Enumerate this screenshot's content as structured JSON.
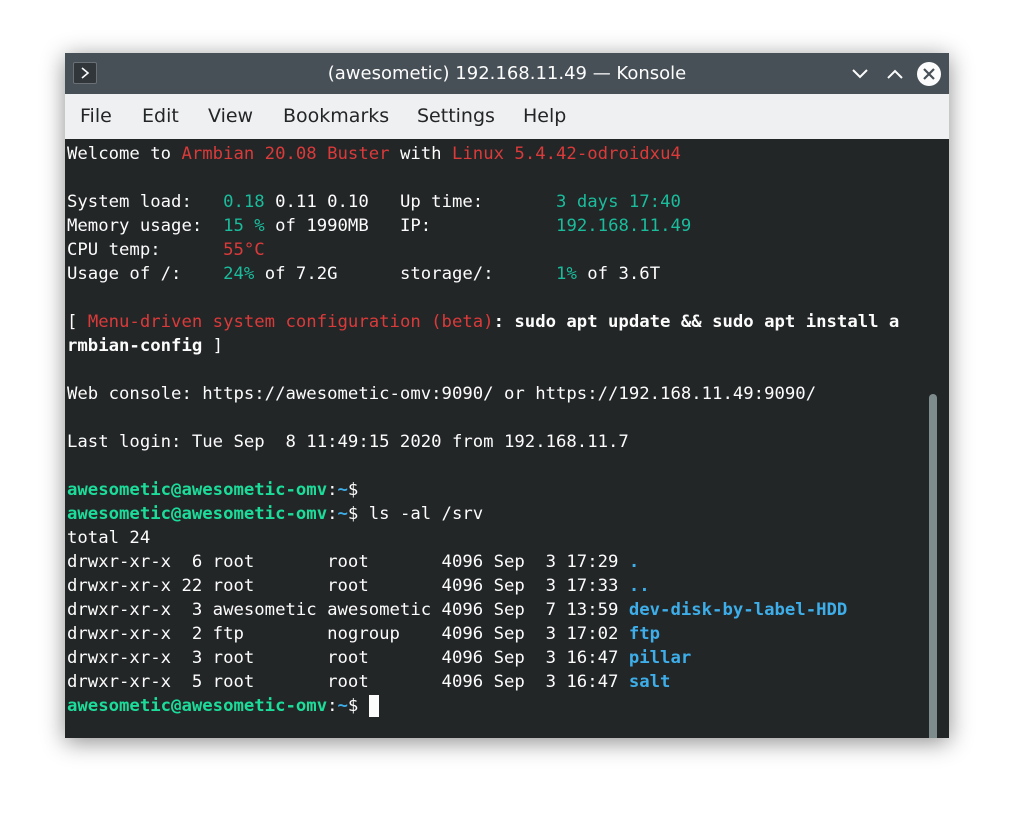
{
  "window": {
    "title": "(awesometic) 192.168.11.49 — Konsole"
  },
  "menubar": {
    "items": [
      "File",
      "Edit",
      "View",
      "Bookmarks",
      "Settings",
      "Help"
    ]
  },
  "terminal": {
    "welcome": {
      "prefix": "Welcome to ",
      "distro": "Armbian 20.08 Buster",
      "mid": " with ",
      "kernel": "Linux 5.4.42-odroidxu4"
    },
    "sysload": {
      "label": "System load:   ",
      "v1": "0.18",
      "rest": " 0.11 0.10   ",
      "uplabel": "Up time:       ",
      "upval": "3 days 17:40"
    },
    "memory": {
      "label": "Memory usage:  ",
      "val": "15 %",
      "rest": " of 1990MB   ",
      "iplabel": "IP:            ",
      "ipval": "192.168.11.49"
    },
    "cpu": {
      "label": "CPU temp:      ",
      "val": "55°C"
    },
    "usage": {
      "label": "Usage of /:    ",
      "val": "24%",
      "rest": " of 7.2G      ",
      "storlabel": "storage/:      ",
      "storval": "1%",
      "storrest": " of 3.6T"
    },
    "config": {
      "open": "[ ",
      "text": "Menu-driven system configuration (beta)",
      "cmd1": ": sudo apt update && sudo apt install a",
      "cmd2": "rmbian-config",
      "close": " ]"
    },
    "webconsole": "Web console: https://awesometic-omv:9090/ or https://192.168.11.49:9090/",
    "lastlogin": "Last login: Tue Sep  8 11:49:15 2020 from 192.168.11.7",
    "prompt": {
      "user": "awesometic@awesometic-omv",
      "colon": ":",
      "path": "~",
      "dollar": "$"
    },
    "command": " ls -al /srv",
    "total": "total 24",
    "listing": [
      {
        "meta": "drwxr-xr-x  6 root       root       4096 Sep  3 17:29 ",
        "name": "."
      },
      {
        "meta": "drwxr-xr-x 22 root       root       4096 Sep  3 17:33 ",
        "name": ".."
      },
      {
        "meta": "drwxr-xr-x  3 awesometic awesometic 4096 Sep  7 13:59 ",
        "name": "dev-disk-by-label-HDD"
      },
      {
        "meta": "drwxr-xr-x  2 ftp        nogroup    4096 Sep  3 17:02 ",
        "name": "ftp"
      },
      {
        "meta": "drwxr-xr-x  3 root       root       4096 Sep  3 16:47 ",
        "name": "pillar"
      },
      {
        "meta": "drwxr-xr-x  5 root       root       4096 Sep  3 16:47 ",
        "name": "salt"
      }
    ]
  },
  "icons": [
    "konsole-icon",
    "minimize-icon",
    "maximize-icon",
    "close-icon"
  ],
  "colors": {
    "background": "#232627",
    "titlebar": "#475057",
    "menubar": "#eff0f1",
    "red": "#da3a3a",
    "green": "#1abc9c",
    "blue": "#3daee9"
  }
}
